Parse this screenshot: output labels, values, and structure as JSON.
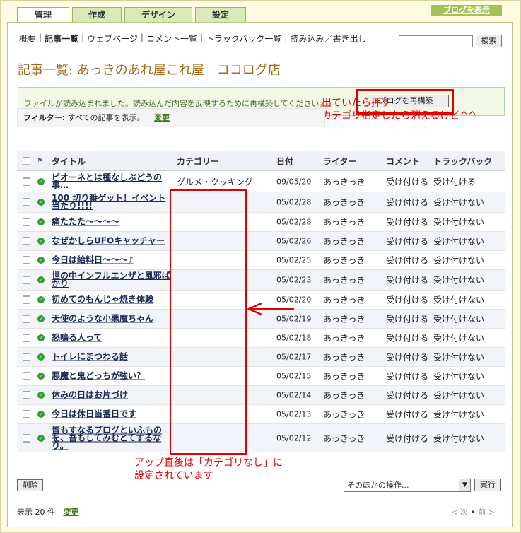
{
  "tabs": [
    {
      "label": "管理",
      "active": true
    },
    {
      "label": "作成",
      "active": false
    },
    {
      "label": "デザイン",
      "active": false
    },
    {
      "label": "設定",
      "active": false
    }
  ],
  "view_blog_label": "ブログを表示",
  "subnav": [
    "概要",
    "記事一覧",
    "ウェブページ",
    "コメント一覧",
    "トラックバック一覧",
    "読み込み／書き出し"
  ],
  "search": {
    "value": "",
    "button": "検索"
  },
  "page_title": "記事一覧: あっきのあれ屋これ屋　ココログ店",
  "notice": {
    "text": "ファイルが読み込まれました。読み込んだ内容を反映するために再構築してください。",
    "rebuild_button": "ブログを再構築"
  },
  "annotation_top": [
    "出ていたら押す",
    "カテゴリ指定したら消えるけど^^"
  ],
  "filter": {
    "label": "フィルター:",
    "text": "すべての記事を表示。",
    "change": "変更"
  },
  "columns": {
    "title": "タイトル",
    "category": "カテゴリー",
    "date": "日付",
    "writer": "ライター",
    "comment": "コメント",
    "trackback": "トラックバック"
  },
  "rows": [
    {
      "title": "ピオーネとは種なしぶどうの事…",
      "category": "グルメ・クッキング",
      "date": "09/05/20",
      "writer": "あっきっき",
      "comment": "受け付ける",
      "trackback": "受け付ける"
    },
    {
      "title": "100 切り番ゲット！イベント当たり!!!!",
      "category": "",
      "date": "05/02/28",
      "writer": "あっきっき",
      "comment": "受け付ける",
      "trackback": "受け付けない"
    },
    {
      "title": "痛たたた～～～～",
      "category": "",
      "date": "05/02/28",
      "writer": "あっきっき",
      "comment": "受け付ける",
      "trackback": "受け付けない"
    },
    {
      "title": "なぜかしらUFOキャッチャー",
      "category": "",
      "date": "05/02/26",
      "writer": "あっきっき",
      "comment": "受け付ける",
      "trackback": "受け付けない"
    },
    {
      "title": "今日は給料日～～～♪",
      "category": "",
      "date": "05/02/25",
      "writer": "あっきっき",
      "comment": "受け付ける",
      "trackback": "受け付けない"
    },
    {
      "title": "世の中インフルエンザと風邪ばかり",
      "category": "",
      "date": "05/02/23",
      "writer": "あっきっき",
      "comment": "受け付ける",
      "trackback": "受け付けない"
    },
    {
      "title": "初めてのもんじゃ焼き体験",
      "category": "",
      "date": "05/02/20",
      "writer": "あっきっき",
      "comment": "受け付ける",
      "trackback": "受け付けない"
    },
    {
      "title": "天使のような小悪魔ちゃん",
      "category": "",
      "date": "05/02/19",
      "writer": "あっきっき",
      "comment": "受け付ける",
      "trackback": "受け付けない"
    },
    {
      "title": "怒鳴る人って",
      "category": "",
      "date": "05/02/18",
      "writer": "あっきっき",
      "comment": "受け付ける",
      "trackback": "受け付けない"
    },
    {
      "title": "トイレにまつわる話",
      "category": "",
      "date": "05/02/17",
      "writer": "あっきっき",
      "comment": "受け付ける",
      "trackback": "受け付けない"
    },
    {
      "title": "悪魔と鬼どっちが強い？",
      "category": "",
      "date": "05/02/15",
      "writer": "あっきっき",
      "comment": "受け付ける",
      "trackback": "受け付けない"
    },
    {
      "title": "休みの日はお片づけ",
      "category": "",
      "date": "05/02/14",
      "writer": "あっきっき",
      "comment": "受け付ける",
      "trackback": "受け付けない"
    },
    {
      "title": "今日は休日当番日です",
      "category": "",
      "date": "05/02/13",
      "writer": "あっきっき",
      "comment": "受け付ける",
      "trackback": "受け付けない"
    },
    {
      "title": "皆もすなるブログといふものを、吾もしてみむとてするなり。",
      "category": "",
      "date": "05/02/12",
      "writer": "あっきっき",
      "comment": "受け付ける",
      "trackback": "受け付けない"
    }
  ],
  "annotation_bottom": [
    "アップ直後は「カテゴリなし」に",
    "設定されています"
  ],
  "delete_button": "削除",
  "ops_select": "そのほかの操作...",
  "exec_button": "実行",
  "perpage": {
    "label": "表示 20 件",
    "change": "変更"
  },
  "pager": {
    "next": "< 次",
    "prev": "前 >"
  }
}
